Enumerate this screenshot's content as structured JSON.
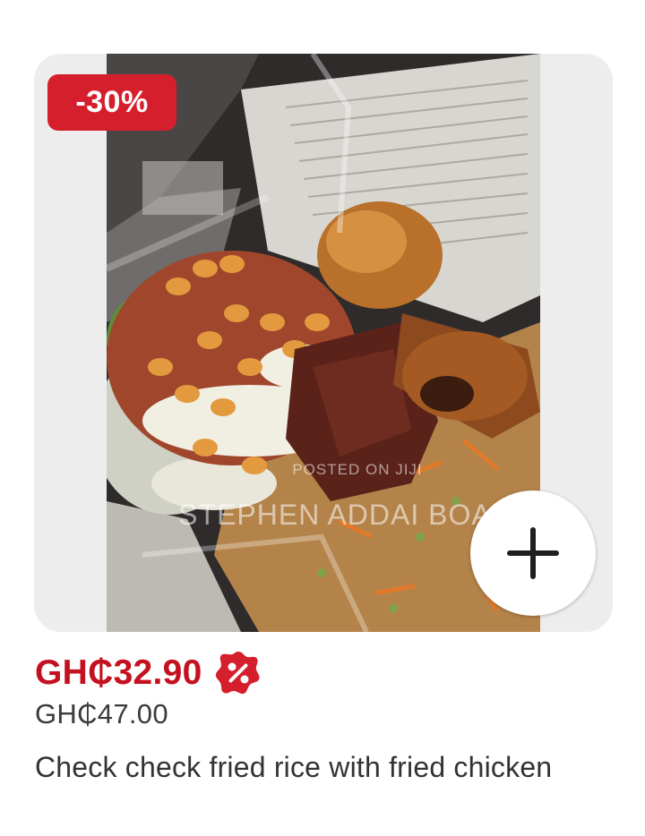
{
  "product": {
    "discount_badge": "-30%",
    "current_price": "GH₵32.90",
    "old_price": "GH₵47.00",
    "title": "Check check fried rice with fried chicken",
    "watermark_top": "POSTED ON JIJI",
    "watermark_main": "STEPHEN ADDAI BOAMAH"
  },
  "icons": {
    "add": "plus-icon",
    "deal": "percent-badge-icon"
  },
  "colors": {
    "accent_red": "#d61f2c",
    "price_red": "#c4101f",
    "old_price_gray": "#3b3b3b",
    "frame_bg": "#ededed"
  }
}
